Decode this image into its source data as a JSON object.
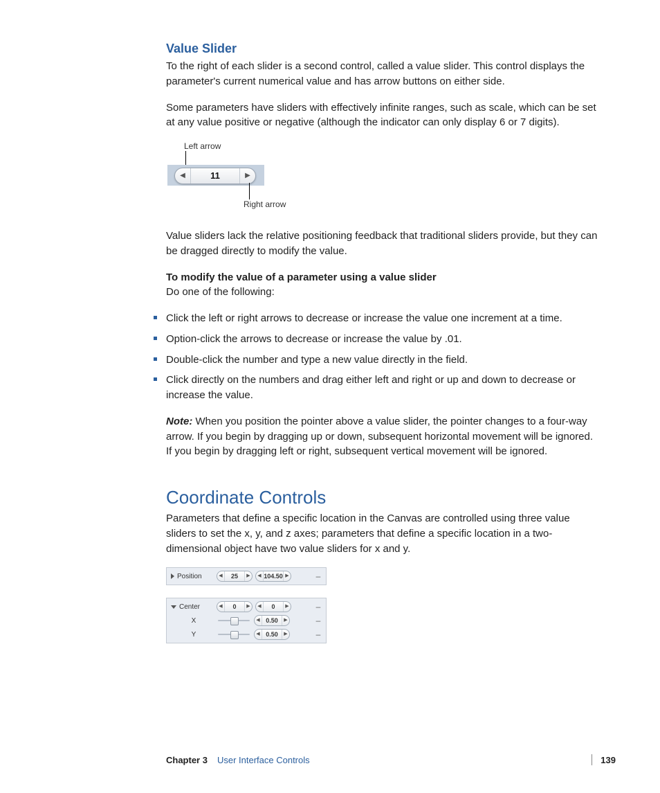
{
  "section1": {
    "title": "Value Slider",
    "p1": "To the right of each slider is a second control, called a value slider. This control displays the parameter's current numerical value and has arrow buttons on either side.",
    "p2": "Some parameters have sliders with effectively infinite ranges, such as scale, which can be set at any value positive or negative (although the indicator can only display 6 or 7 digits).",
    "callout_left": "Left arrow",
    "callout_right": "Right arrow",
    "slider_value": "11",
    "p3": "Value sliders lack the relative positioning feedback that traditional sliders provide, but they can be dragged directly to modify the value.",
    "howto_title": "To modify the value of a parameter using a value slider",
    "howto_sub": "Do one of the following:",
    "bullets": [
      "Click the left or right arrows to decrease or increase the value one increment at a time.",
      "Option-click the arrows to decrease or increase the value by .01.",
      "Double-click the number and type a new value directly in the field.",
      "Click directly on the numbers and drag either left and right or up and down to decrease or increase the value."
    ],
    "note_label": "Note:",
    "note_body": "  When you position the pointer above a value slider, the pointer changes to a four-way arrow. If you begin by dragging up or down, subsequent horizontal movement will be ignored. If you begin by dragging left or right, subsequent vertical movement will be ignored."
  },
  "section2": {
    "title": "Coordinate Controls",
    "p1": "Parameters that define a specific location in the Canvas are controlled using three value sliders to set the x, y, and z axes; parameters that define a specific location in a two-dimensional object have two value sliders for x and y.",
    "panel1": {
      "label": "Position",
      "v1": "25",
      "v2": "104.50"
    },
    "panel2": {
      "label": "Center",
      "row0": {
        "v1": "0",
        "v2": "0"
      },
      "rowX": {
        "label": "X",
        "v": "0.50"
      },
      "rowY": {
        "label": "Y",
        "v": "0.50"
      }
    }
  },
  "footer": {
    "chapter": "Chapter 3",
    "title": "User Interface Controls",
    "page": "139"
  }
}
